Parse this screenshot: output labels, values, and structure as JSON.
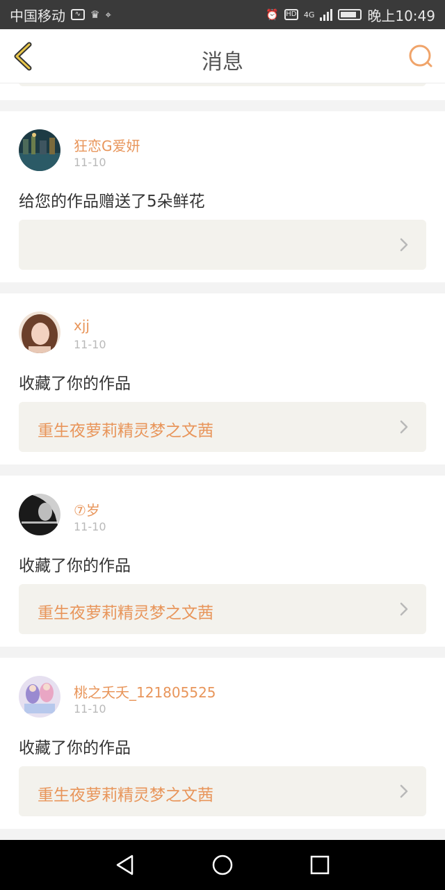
{
  "status_bar": {
    "carrier": "中国移动",
    "network": "4G",
    "time": "晚上10:49",
    "icons": [
      "activity-icon",
      "app-badge-icon",
      "location-icon",
      "alarm-icon",
      "hd-icon",
      "signal-icon",
      "battery-icon"
    ]
  },
  "header": {
    "title": "消息",
    "back_icon": "back-chevron-icon",
    "search_icon": "search-icon",
    "accent": "#e8955a"
  },
  "messages": [
    {
      "username": "狂恋G爱妍",
      "date": "11-10",
      "action": "给您的作品赠送了5朵鲜花",
      "work_title": ""
    },
    {
      "username": "xjj",
      "date": "11-10",
      "action": "收藏了你的作品",
      "work_title": "重生夜萝莉精灵梦之文茜"
    },
    {
      "username": "⑦岁",
      "date": "11-10",
      "action": "收藏了你的作品",
      "work_title": "重生夜萝莉精灵梦之文茜"
    },
    {
      "username": "桃之夭夭_121805525",
      "date": "11-10",
      "action": "收藏了你的作品",
      "work_title": "重生夜萝莉精灵梦之文茜"
    }
  ],
  "nav_bar": {
    "buttons": [
      "back-triangle-icon",
      "home-circle-icon",
      "recents-square-icon"
    ]
  }
}
